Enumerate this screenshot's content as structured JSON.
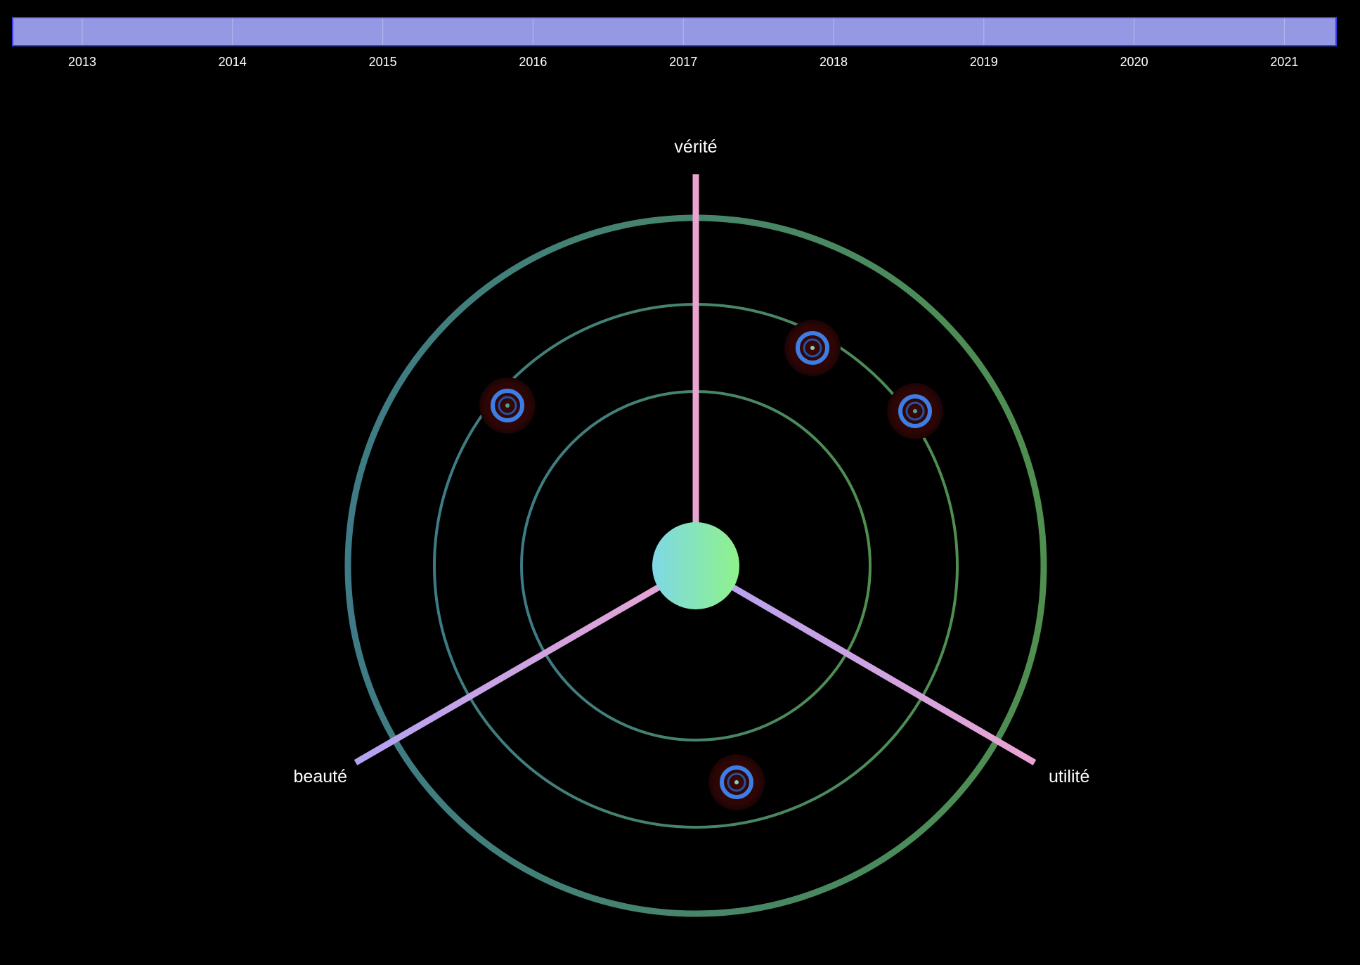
{
  "timeline": {
    "years": [
      "2013",
      "2014",
      "2015",
      "2016",
      "2017",
      "2018",
      "2019",
      "2020",
      "2021"
    ],
    "bar_color": "#9599e3",
    "border_color": "#3b3ef0"
  },
  "radar": {
    "axes": [
      {
        "key": "top",
        "label": "vérité"
      },
      {
        "key": "left",
        "label": "beauté"
      },
      {
        "key": "right",
        "label": "utilité"
      }
    ],
    "ring_colors": {
      "left": "#3e7b86",
      "right": "#4f8f4f"
    },
    "axis_colors": {
      "pink": "#eaa4d2",
      "lavender": "#b3a2f2"
    },
    "hub_colors": {
      "left": "#7ed8e6",
      "right": "#8ff28a"
    },
    "marker_colors": {
      "halo": "#3a0707",
      "ring": "#3d7ee6",
      "core": "#4aa88a"
    }
  }
}
